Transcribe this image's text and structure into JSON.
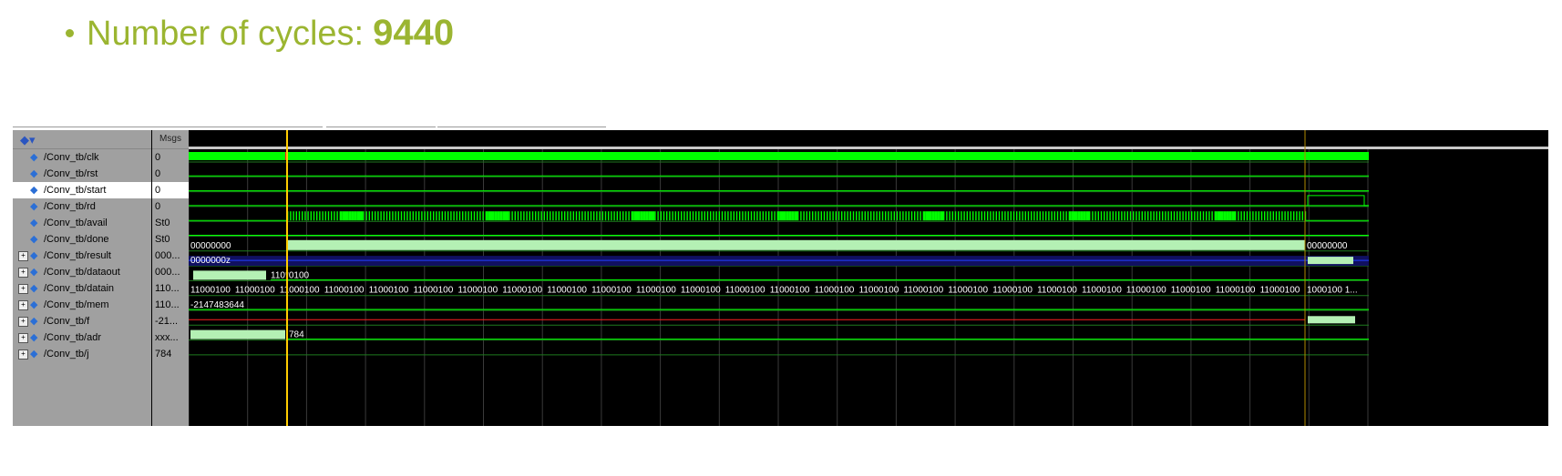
{
  "slide": {
    "label": "Number of cycles:",
    "value": "9440",
    "accent_color": "#9bb531"
  },
  "wave": {
    "msgs_header": "Msgs",
    "toolbar_icon": "waveform-icon",
    "signals": [
      {
        "name": "/Conv_tb/clk",
        "value": "0",
        "expandable": false
      },
      {
        "name": "/Conv_tb/rst",
        "value": "0",
        "expandable": false
      },
      {
        "name": "/Conv_tb/start",
        "value": "0",
        "expandable": false,
        "selected": true
      },
      {
        "name": "/Conv_tb/rd",
        "value": "0",
        "expandable": false
      },
      {
        "name": "/Conv_tb/avail",
        "value": "St0",
        "expandable": false
      },
      {
        "name": "/Conv_tb/done",
        "value": "St0",
        "expandable": false
      },
      {
        "name": "/Conv_tb/result",
        "value": "000...",
        "expandable": true
      },
      {
        "name": "/Conv_tb/dataout",
        "value": "000...",
        "expandable": true
      },
      {
        "name": "/Conv_tb/datain",
        "value": "110...",
        "expandable": true
      },
      {
        "name": "/Conv_tb/mem",
        "value": "110...",
        "expandable": true
      },
      {
        "name": "/Conv_tb/f",
        "value": "-21...",
        "expandable": true
      },
      {
        "name": "/Conv_tb/adr",
        "value": "xxx...",
        "expandable": true
      },
      {
        "name": "/Conv_tb/j",
        "value": "784",
        "expandable": true
      }
    ],
    "bus_labels": {
      "result_start": "00000000",
      "result_end": "00000000",
      "dataout_start": "0000000z",
      "datain_end": "110*0100",
      "mem_cell": "11000100",
      "mem_end": "1000100 1...",
      "f_value": "-2147483644",
      "j_value": "784"
    },
    "colors": {
      "signal": "#00ff00",
      "bus_fill": "#b4f0b4",
      "cursor": "#ffcc00",
      "undefined": "#ff2020",
      "highz": "#2040ff"
    }
  }
}
